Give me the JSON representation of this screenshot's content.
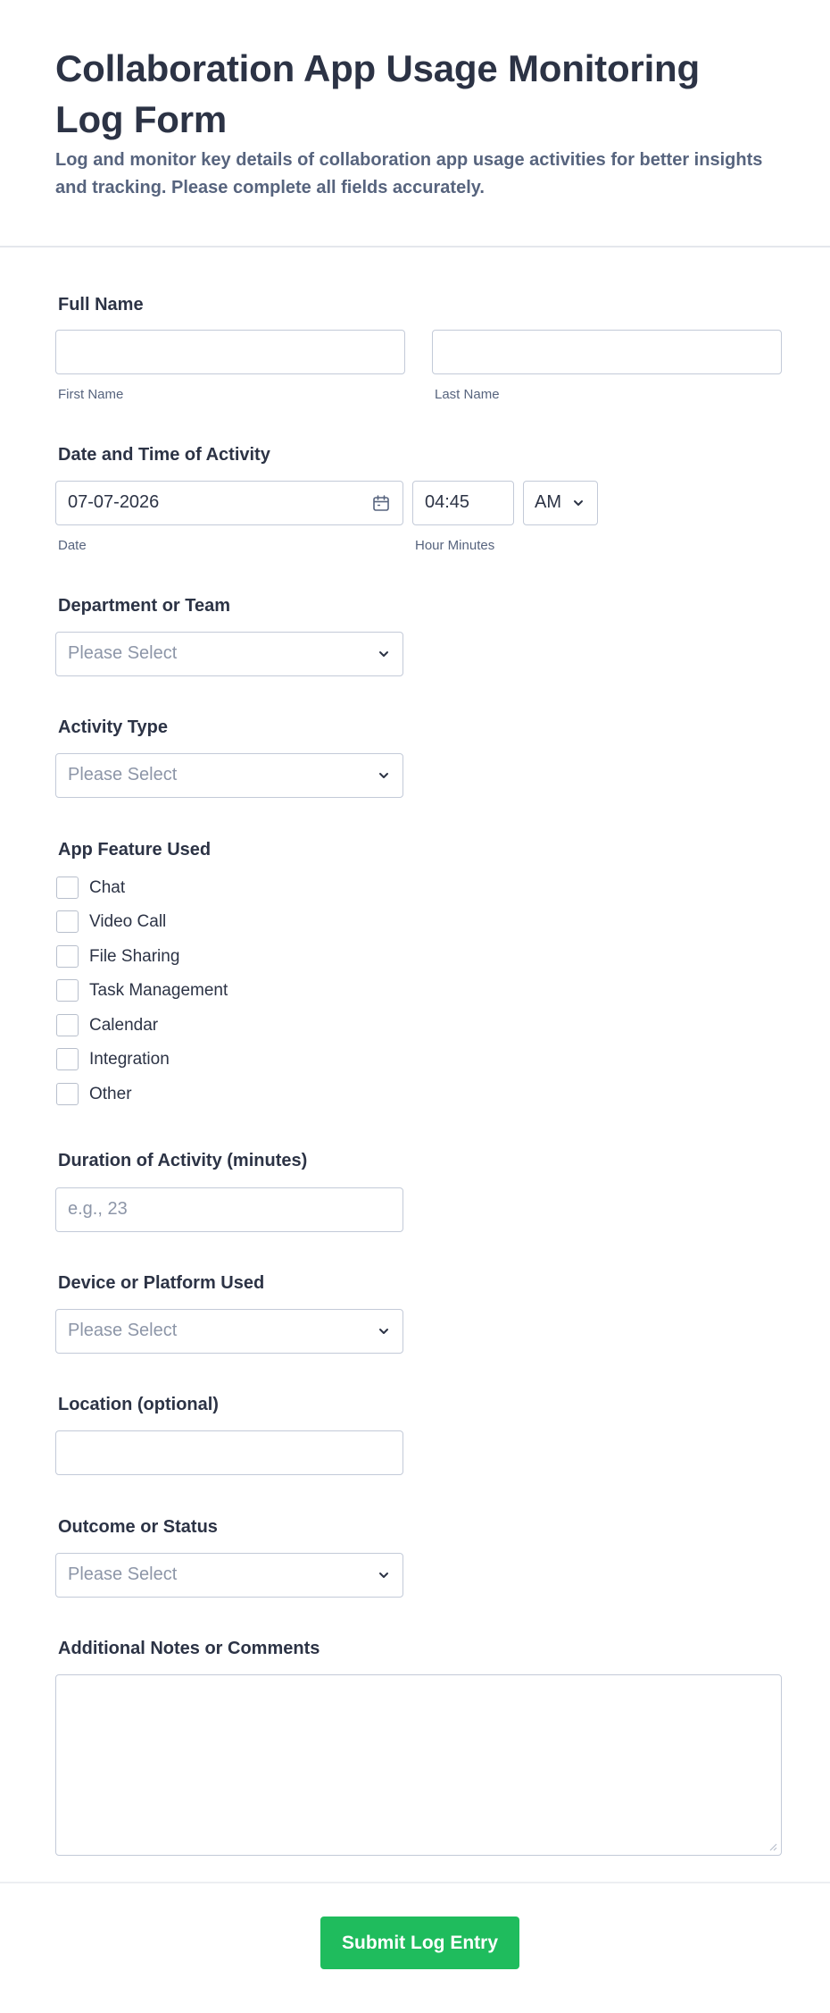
{
  "header": {
    "title": "Collaboration App Usage Monitoring Log Form",
    "subtitle": "Log and monitor key details of collaboration app usage activities for better insights and tracking. Please complete all fields accurately."
  },
  "full_name": {
    "label": "Full Name",
    "first_value": "",
    "last_value": "",
    "first_sublabel": "First Name",
    "last_sublabel": "Last Name"
  },
  "datetime": {
    "label": "Date and Time of Activity",
    "date_value": "07-07-2026",
    "time_value": "04:45",
    "ampm_value": "AM",
    "date_sublabel": "Date",
    "time_sublabel": "Hour Minutes",
    "date_icon": "calendar-icon"
  },
  "department": {
    "label": "Department or Team",
    "placeholder": "Please Select"
  },
  "activity_type": {
    "label": "Activity Type",
    "placeholder": "Please Select"
  },
  "app_feature": {
    "label": "App Feature Used",
    "options": [
      "Chat",
      "Video Call",
      "File Sharing",
      "Task Management",
      "Calendar",
      "Integration",
      "Other"
    ]
  },
  "duration": {
    "label": "Duration of Activity (minutes)",
    "placeholder": "e.g., 23"
  },
  "device": {
    "label": "Device or Platform Used",
    "placeholder": "Please Select"
  },
  "location": {
    "label": "Location (optional)",
    "value": ""
  },
  "outcome": {
    "label": "Outcome or Status",
    "placeholder": "Please Select"
  },
  "notes": {
    "label": "Additional Notes or Comments",
    "value": ""
  },
  "submit": {
    "label": "Submit Log Entry"
  },
  "colors": {
    "accent_submit": "#1fbc5d",
    "text_primary": "#2c3345",
    "text_secondary": "#57647e",
    "input_border": "#c3cad8",
    "placeholder": "#8d96a8"
  }
}
